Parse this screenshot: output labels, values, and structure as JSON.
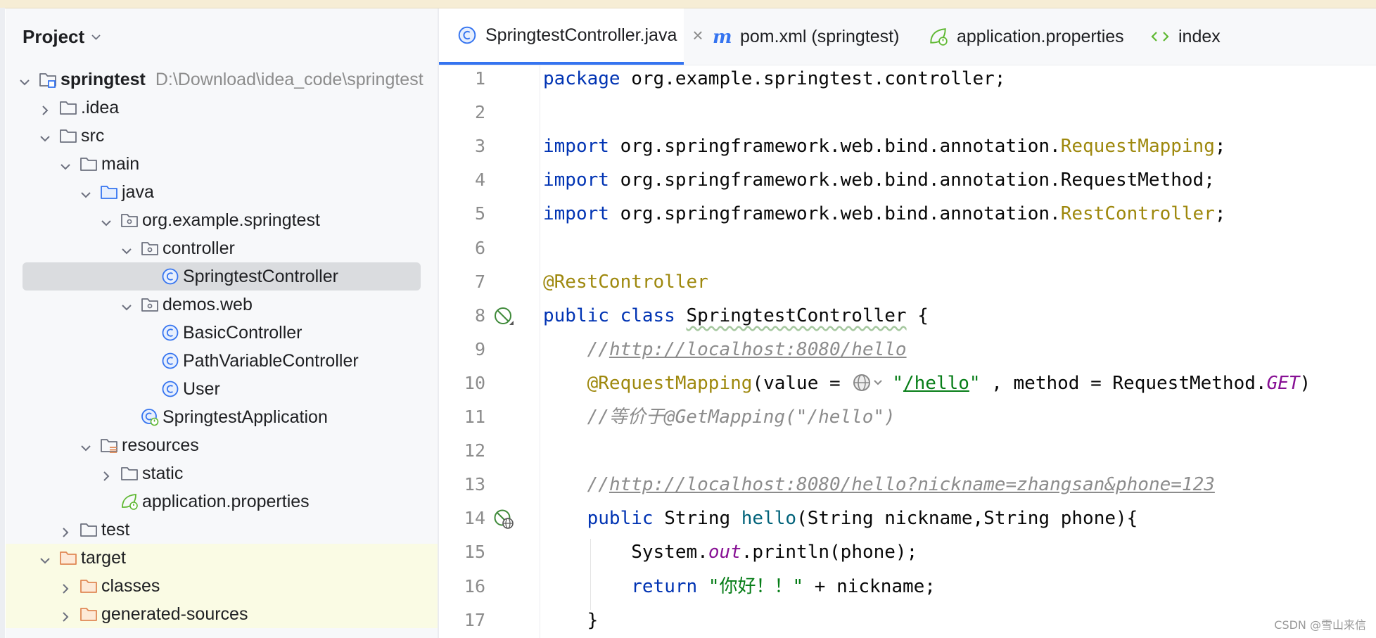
{
  "project_panel": {
    "title": "Project",
    "tree": [
      {
        "label": "springtest",
        "hint": "D:\\Download\\idea_code\\springtest",
        "icon": "module-folder-icon",
        "arrow": "down",
        "level": 0,
        "bold": true
      },
      {
        "label": ".idea",
        "icon": "folder-icon",
        "arrow": "right",
        "level": 1
      },
      {
        "label": "src",
        "icon": "folder-icon",
        "arrow": "down",
        "level": 1
      },
      {
        "label": "main",
        "icon": "folder-icon",
        "arrow": "down",
        "level": 2
      },
      {
        "label": "java",
        "icon": "source-folder-icon",
        "arrow": "down",
        "level": 3
      },
      {
        "label": "org.example.springtest",
        "icon": "package-icon",
        "arrow": "down",
        "level": 4
      },
      {
        "label": "controller",
        "icon": "package-icon",
        "arrow": "down",
        "level": 5
      },
      {
        "label": "SpringtestController",
        "icon": "class-icon",
        "arrow": "",
        "level": 6,
        "selected": true
      },
      {
        "label": "demos.web",
        "icon": "package-icon",
        "arrow": "down",
        "level": 5
      },
      {
        "label": "BasicController",
        "icon": "class-icon",
        "arrow": "",
        "level": 6
      },
      {
        "label": "PathVariableController",
        "icon": "class-icon",
        "arrow": "",
        "level": 6
      },
      {
        "label": "User",
        "icon": "class-icon",
        "arrow": "",
        "level": 6
      },
      {
        "label": "SpringtestApplication",
        "icon": "spring-class-icon",
        "arrow": "",
        "level": 5
      },
      {
        "label": "resources",
        "icon": "resources-folder-icon",
        "arrow": "down",
        "level": 3
      },
      {
        "label": "static",
        "icon": "folder-icon",
        "arrow": "right",
        "level": 4
      },
      {
        "label": "application.properties",
        "icon": "spring-properties-icon",
        "arrow": "",
        "level": 4
      },
      {
        "label": "test",
        "icon": "folder-icon",
        "arrow": "right",
        "level": 2
      },
      {
        "label": "target",
        "icon": "excluded-folder-icon",
        "arrow": "down",
        "level": 1,
        "target": true
      },
      {
        "label": "classes",
        "icon": "excluded-folder-icon",
        "arrow": "right",
        "level": 2,
        "target": true
      },
      {
        "label": "generated-sources",
        "icon": "excluded-folder-icon",
        "arrow": "right",
        "level": 2,
        "target": true
      }
    ]
  },
  "tabs": [
    {
      "label": "SpringtestController.java",
      "icon": "class-icon",
      "active": true,
      "closable": true
    },
    {
      "label": "pom.xml (springtest)",
      "icon": "maven-icon"
    },
    {
      "label": "application.properties",
      "icon": "spring-properties-icon"
    },
    {
      "label": "index",
      "icon": "html-icon"
    }
  ],
  "editor": {
    "lines": [
      {
        "n": "1",
        "html": "<span class=\"kw\">package</span> org.example.springtest.controller;"
      },
      {
        "n": "2",
        "html": ""
      },
      {
        "n": "3",
        "html": "<span class=\"kw\">import</span> org.springframework.web.bind.annotation.<span class=\"ann\">RequestMapping</span>;"
      },
      {
        "n": "4",
        "html": "<span class=\"kw\">import</span> org.springframework.web.bind.annotation.RequestMethod;"
      },
      {
        "n": "5",
        "html": "<span class=\"kw\">import</span> org.springframework.web.bind.annotation.<span class=\"ann\">RestController</span>;"
      },
      {
        "n": "6",
        "html": ""
      },
      {
        "n": "7",
        "html": "<span class=\"ann\">@RestController</span>"
      },
      {
        "n": "8",
        "html": "<span class=\"kw\">public class</span> <span class=\"wavy\">SpringtestController</span> {",
        "gutter": "bean-icon"
      },
      {
        "n": "9",
        "html": "    <span class=\"cm\">//<span class=\"u\">http://localhost:8080/hello</span></span>"
      },
      {
        "n": "10",
        "html": "    <span class=\"ann\">@RequestMapping</span>(value = <span class=\"inlay\" data-name=\"globe-inlay-icon\" data-interactable=\"true\"><svg width=\"58\" height=\"30\" viewBox=\"0 0 58 30\"><circle cx=\"15\" cy=\"15\" r=\"11\" fill=\"#eeeeee\" stroke=\"#888\" stroke-width=\"2\"/><ellipse cx=\"15\" cy=\"15\" rx=\"5\" ry=\"11\" fill=\"none\" stroke=\"#888\" stroke-width=\"1.6\"/><line x1=\"4\" y1=\"15\" x2=\"26\" y2=\"15\" stroke=\"#888\" stroke-width=\"1.6\"/><path d=\"M33 12 L38 17 L43 12\" fill=\"none\" stroke=\"#888\" stroke-width=\"2\"/></svg></span><span class=\"str\">\"<span class=\"u\">/hello</span>\"</span> , method = RequestMethod.<span class=\"fld\">GET</span>)"
      },
      {
        "n": "11",
        "html": "    <span class=\"cm\">//等价于@GetMapping(\"/hello\")</span>"
      },
      {
        "n": "12",
        "html": ""
      },
      {
        "n": "13",
        "html": "    <span class=\"cm\">//<span class=\"u\">http://localhost:8080/hello?nickname=zhangsan&amp;phone=123</span></span>"
      },
      {
        "n": "14",
        "html": "    <span class=\"kw\">public</span> String <span class=\"fn\">hello</span>(String nickname,String phone){",
        "gutter": "endpoint-icon"
      },
      {
        "n": "15",
        "html": "        System.<span class=\"fld\">out</span>.println(phone);"
      },
      {
        "n": "16",
        "html": "        <span class=\"kw\">return</span> <span class=\"str\">\"你好！！\"</span> + nickname;"
      },
      {
        "n": "17",
        "html": "    }"
      }
    ]
  },
  "watermark": "CSDN @雪山来信",
  "colors": {
    "accent": "#3574f0",
    "keyword": "#0033b3",
    "annotation": "#9e880d",
    "string": "#067d17",
    "comment": "#8c8c8c"
  }
}
